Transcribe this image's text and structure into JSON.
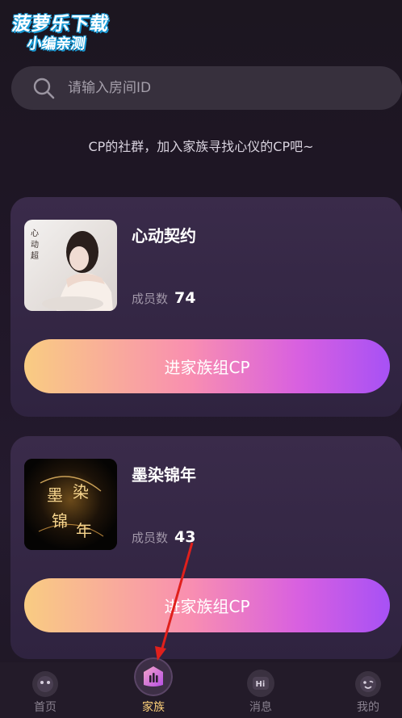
{
  "watermark": {
    "line1": "菠萝乐下载",
    "line2": "小编亲测"
  },
  "search": {
    "placeholder": "请输入房间ID"
  },
  "intro_text": "CP的社群，加入家族寻找心仪的CP吧~",
  "families": [
    {
      "name": "心动契约",
      "members_label": "成员数",
      "members_count": "74",
      "join_label": "进家族组CP",
      "thumb_text": "心动超"
    },
    {
      "name": "墨染锦年",
      "members_label": "成员数",
      "members_count": "43",
      "join_label": "进家族组CP",
      "thumb_text": "墨染锦年"
    }
  ],
  "tabs": [
    {
      "label": "首页",
      "icon": "home-face-icon"
    },
    {
      "label": "家族",
      "icon": "family-icon",
      "active": true
    },
    {
      "label": "消息",
      "icon": "hi-message-icon"
    },
    {
      "label": "我的",
      "icon": "profile-face-icon"
    }
  ],
  "colors": {
    "background": "#1f1626",
    "card": "#35283f",
    "button_gradient_start": "#f9cc82",
    "button_gradient_end": "#a751f5",
    "active_tab": "#ffd27a",
    "annotation_arrow": "#e0201c"
  }
}
